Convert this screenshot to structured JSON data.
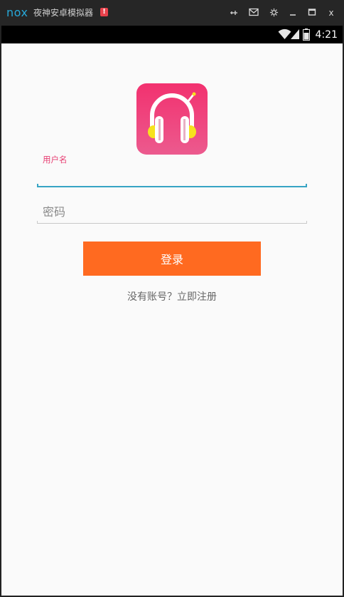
{
  "emulator": {
    "logo_text": "nox",
    "title": "夜神安卓模拟器",
    "alert_badge": "!",
    "controls": {
      "pin_icon": "pin-icon",
      "mail_icon": "mail-icon",
      "settings_icon": "gear-icon",
      "minimize_icon": "minimize-icon",
      "maximize_icon": "maximize-icon",
      "close_label": "x"
    }
  },
  "status_bar": {
    "time": "4:21",
    "icons": [
      "wifi-icon",
      "cellular-signal-icon",
      "battery-icon"
    ]
  },
  "login": {
    "app_icon": "headphones-icon",
    "username_label": "用户名",
    "username_value": "",
    "password_placeholder": "密码",
    "password_value": "",
    "login_button_label": "登录",
    "register_link": "没有账号？立即注册"
  },
  "colors": {
    "accent_pink": "#e73e72",
    "input_focus": "#37a4c4",
    "login_button": "#ff6a20",
    "nox_logo": "#27a8d8",
    "alert_red": "#e8414b"
  }
}
